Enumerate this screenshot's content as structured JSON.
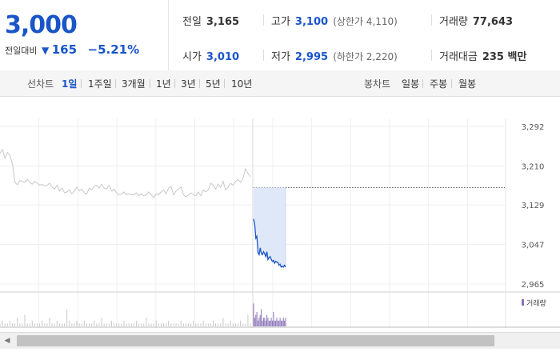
{
  "quote": {
    "price": "3,000",
    "change_label": "전일대비",
    "change_icon": "down-triangle-icon",
    "change_value": "165",
    "change_rate": "−5.21%",
    "prev_label": "전일",
    "prev_value": "3,165",
    "high_label": "고가",
    "high_value": "3,100",
    "high_note": "(상한가 4,110)",
    "volume_label": "거래량",
    "volume_value": "77,643",
    "open_label": "시가",
    "open_value": "3,010",
    "low_label": "저가",
    "low_value": "2,995",
    "low_note": "(하한가 2,220)",
    "amount_label": "거래대금",
    "amount_value": "235 백만"
  },
  "periods": {
    "line_label": "선차트",
    "line_items": [
      "1일",
      "1주일",
      "3개월",
      "1년",
      "3년",
      "5년",
      "10년"
    ],
    "selected": "1일",
    "candle_label": "봉차트",
    "candle_items": [
      "일봉",
      "주봉",
      "월봉"
    ]
  },
  "colors": {
    "accent": "#1a55c9",
    "prev_line": "#c8c8c8",
    "volume": "#8a72b8"
  },
  "chart_data": [
    {
      "type": "line",
      "title": "",
      "y_ticks": [
        "3,292",
        "3,210",
        "3,129",
        "3,047",
        "2,965"
      ],
      "ylim": [
        2965,
        3292
      ],
      "reference_line": 3165,
      "series": [
        {
          "values": [
            3236,
            3244,
            3226,
            3238,
            3232,
            3214,
            3176,
            3171,
            3180,
            3178,
            3176,
            3182,
            3176,
            3172,
            3178,
            3174,
            3170,
            3172,
            3168,
            3170,
            3174,
            3166,
            3162,
            3170,
            3158,
            3164,
            3154,
            3156,
            3160,
            3152,
            3158,
            3166,
            3158,
            3162,
            3154,
            3152,
            3164,
            3160,
            3168,
            3170,
            3164,
            3172,
            3164,
            3162,
            3170,
            3158,
            3162,
            3154,
            3150,
            3152,
            3156,
            3150,
            3152,
            3150,
            3150,
            3154,
            3148,
            3152,
            3148,
            3150,
            3156,
            3150,
            3144,
            3152,
            3150,
            3156,
            3160,
            3152,
            3164,
            3168,
            3150,
            3158,
            3162,
            3166,
            3150,
            3146,
            3150,
            3154,
            3150,
            3148,
            3156,
            3148,
            3160,
            3156,
            3160,
            3174,
            3170,
            3162,
            3172,
            3166,
            3178,
            3160,
            3166,
            3174,
            3170,
            3178,
            3182,
            3176,
            3184,
            3204,
            3194,
            3188
          ]
        },
        {
          "values": [
            3100,
            3088,
            3060,
            3064,
            3030,
            3026,
            3040,
            3028,
            3026,
            3032,
            3028,
            3022,
            3032,
            3016,
            3020,
            3022,
            3016,
            3012,
            3014,
            3008,
            3012,
            3010,
            3010,
            3004,
            3006,
            3000,
            3002,
            3000,
            3004,
            3000
          ]
        }
      ]
    },
    {
      "type": "bar",
      "title": "",
      "legend": "거래량",
      "ylim": [
        0,
        10
      ],
      "series": [
        {
          "values": [
            1,
            2,
            1,
            1,
            2,
            1,
            1,
            3,
            1,
            1,
            4,
            1,
            1,
            2,
            1,
            1,
            1,
            2,
            1,
            1,
            3,
            1,
            1,
            2,
            1,
            1,
            1,
            6,
            2,
            1,
            1,
            2,
            1,
            1,
            2,
            1,
            1,
            1,
            2,
            1,
            1,
            3,
            1,
            1,
            1,
            2,
            1,
            1,
            1,
            1,
            2,
            1,
            1,
            1,
            1,
            2,
            1,
            1,
            1,
            3,
            1,
            1,
            1,
            2,
            1,
            1,
            1,
            1,
            2,
            1,
            1,
            1,
            1,
            2,
            1,
            1,
            1,
            1,
            2,
            1,
            1,
            1,
            2,
            1,
            1,
            1,
            2,
            1,
            1,
            1,
            3,
            1,
            1,
            2,
            1,
            1,
            1,
            2,
            1,
            1,
            4,
            1
          ]
        },
        {
          "values": [
            8,
            3,
            4,
            5,
            2,
            3,
            4,
            6,
            2,
            3,
            3,
            2,
            4,
            3,
            2,
            2,
            3,
            2,
            5,
            2,
            2,
            3,
            2,
            2,
            3,
            2,
            2,
            3,
            2,
            3
          ]
        }
      ]
    }
  ]
}
